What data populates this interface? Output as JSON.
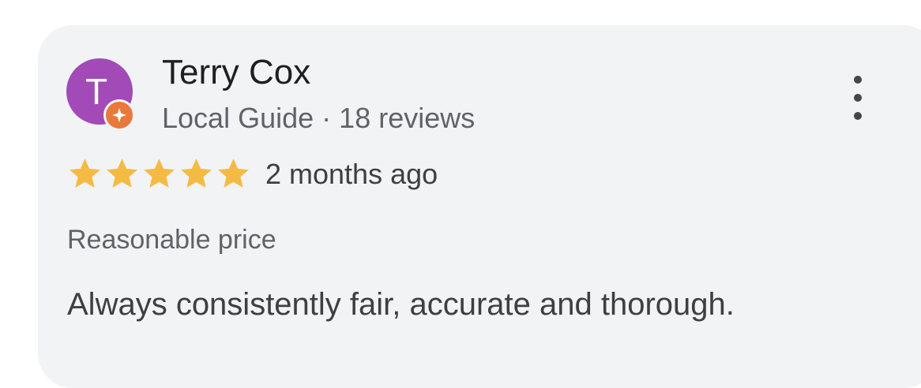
{
  "review": {
    "author": {
      "initial": "T",
      "name": "Terry Cox",
      "badge": "Local Guide",
      "separator": "·",
      "review_count": "18 reviews",
      "avatar_color": "#a24ab8",
      "badge_icon": "local-guide-star-icon"
    },
    "rating": {
      "stars": 5,
      "max": 5,
      "star_color": "#f4bb44"
    },
    "time": "2 months ago",
    "highlight": "Reasonable price",
    "text": "Always consistently fair, accurate and thorough."
  },
  "menu_icon": "more-vert-icon"
}
